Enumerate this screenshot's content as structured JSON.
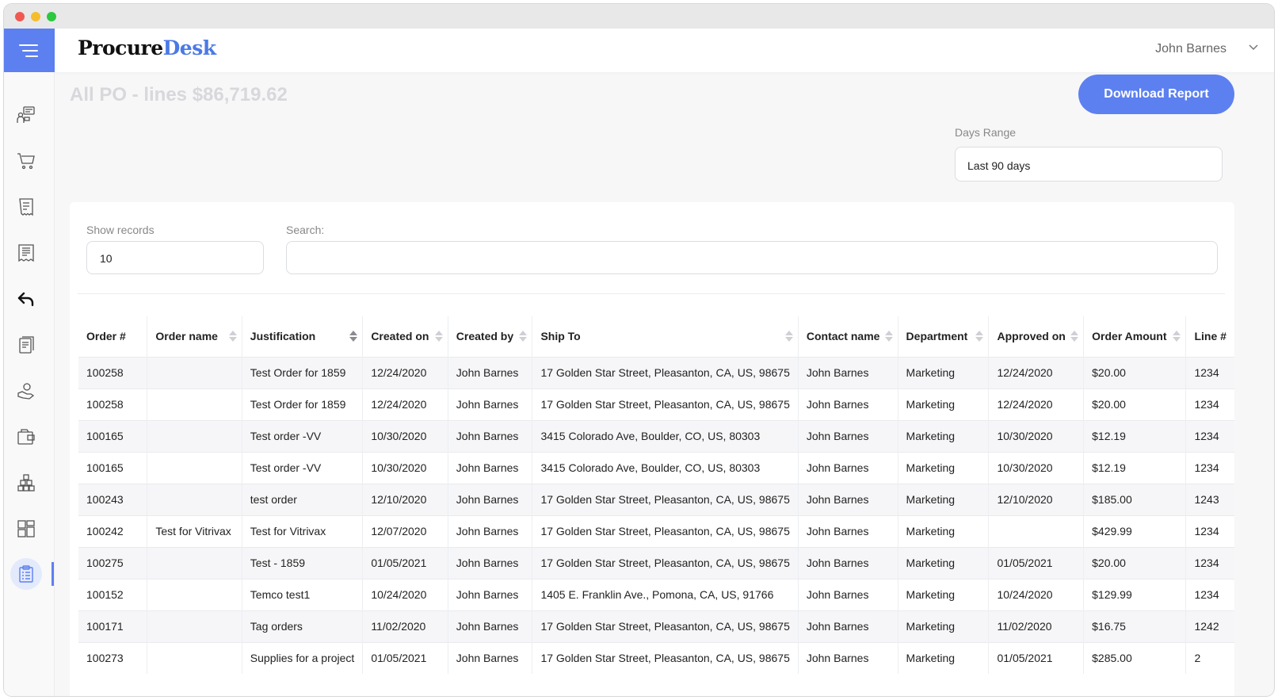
{
  "app": {
    "logo_part1": "Procure",
    "logo_part2": "Desk",
    "user_name": "John Barnes",
    "accent_color": "#5d80f0"
  },
  "sidebar": {
    "items": [
      {
        "icon": "requests-chat-icon"
      },
      {
        "icon": "cart-icon"
      },
      {
        "icon": "receipt-icon"
      },
      {
        "icon": "invoice-icon"
      },
      {
        "icon": "return-arrow-icon"
      },
      {
        "icon": "document-edit-icon"
      },
      {
        "icon": "hand-money-icon"
      },
      {
        "icon": "folder-icon"
      },
      {
        "icon": "boxes-icon"
      },
      {
        "icon": "dashboard-grid-icon"
      },
      {
        "icon": "clipboard-report-icon",
        "active": true
      }
    ]
  },
  "page": {
    "title": "All PO - lines $86,719.62",
    "download_label": "Download Report",
    "days_range_label": "Days Range",
    "days_range_value": "Last 90 days",
    "show_records_label": "Show records",
    "show_records_value": "10",
    "search_label": "Search:",
    "search_value": ""
  },
  "table": {
    "columns": [
      "Order #",
      "Order name",
      "Justification",
      "Created on",
      "Created by",
      "Ship To",
      "Contact name",
      "Department",
      "Approved on",
      "Order Amount",
      "Line #"
    ],
    "rows": [
      [
        "100258",
        "",
        "Test Order for 1859",
        "12/24/2020",
        "John Barnes",
        "17 Golden Star Street, Pleasanton, CA, US, 98675",
        "John Barnes",
        "Marketing",
        "12/24/2020",
        "$20.00",
        "1234"
      ],
      [
        "100258",
        "",
        "Test Order for 1859",
        "12/24/2020",
        "John Barnes",
        "17 Golden Star Street, Pleasanton, CA, US, 98675",
        "John Barnes",
        "Marketing",
        "12/24/2020",
        "$20.00",
        "1234"
      ],
      [
        "100165",
        "",
        "Test order -VV",
        "10/30/2020",
        "John Barnes",
        "3415 Colorado Ave, Boulder, CO, US, 80303",
        "John Barnes",
        "Marketing",
        "10/30/2020",
        "$12.19",
        "1234"
      ],
      [
        "100165",
        "",
        "Test order -VV",
        "10/30/2020",
        "John Barnes",
        "3415 Colorado Ave, Boulder, CO, US, 80303",
        "John Barnes",
        "Marketing",
        "10/30/2020",
        "$12.19",
        "1234"
      ],
      [
        "100243",
        "",
        "test order",
        "12/10/2020",
        "John Barnes",
        "17 Golden Star Street, Pleasanton, CA, US, 98675",
        "John Barnes",
        "Marketing",
        "12/10/2020",
        "$185.00",
        "1243"
      ],
      [
        "100242",
        "Test for Vitrivax",
        "Test for Vitrivax",
        "12/07/2020",
        "John Barnes",
        "17 Golden Star Street, Pleasanton, CA, US, 98675",
        "John Barnes",
        "Marketing",
        "",
        "$429.99",
        "1234"
      ],
      [
        "100275",
        "",
        "Test - 1859",
        "01/05/2021",
        "John Barnes",
        "17 Golden Star Street, Pleasanton, CA, US, 98675",
        "John Barnes",
        "Marketing",
        "01/05/2021",
        "$20.00",
        "1234"
      ],
      [
        "100152",
        "",
        "Temco test1",
        "10/24/2020",
        "John Barnes",
        "1405 E. Franklin Ave., Pomona, CA, US, 91766",
        "John Barnes",
        "Marketing",
        "10/24/2020",
        "$129.99",
        "1234"
      ],
      [
        "100171",
        "",
        "Tag orders",
        "11/02/2020",
        "John Barnes",
        "17 Golden Star Street, Pleasanton, CA, US, 98675",
        "John Barnes",
        "Marketing",
        "11/02/2020",
        "$16.75",
        "1242"
      ],
      [
        "100273",
        "",
        "Supplies for a project",
        "01/05/2021",
        "John Barnes",
        "17 Golden Star Street, Pleasanton, CA, US, 98675",
        "John Barnes",
        "Marketing",
        "01/05/2021",
        "$285.00",
        "2"
      ]
    ]
  }
}
